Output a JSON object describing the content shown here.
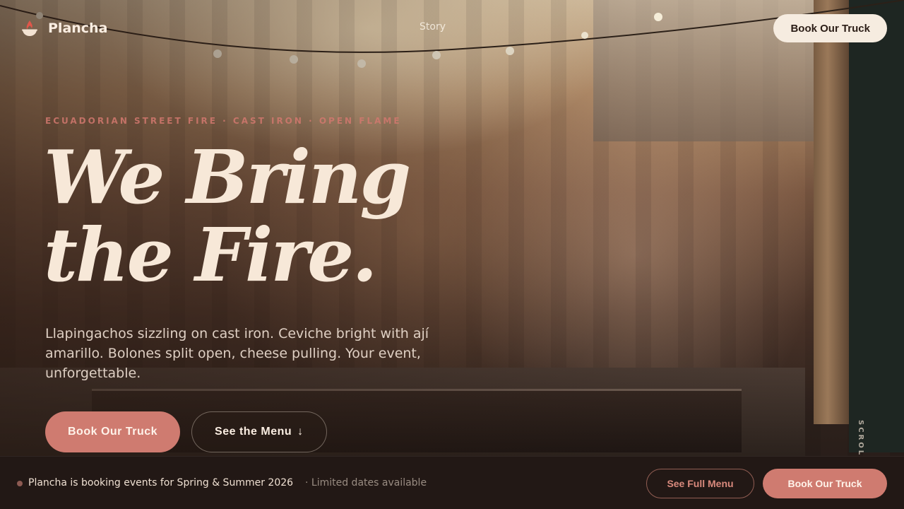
{
  "brand": {
    "name": "Plancha",
    "icon": "flame-grill-icon"
  },
  "nav": {
    "links": [
      "Story"
    ],
    "cta_label": "Book Our Truck"
  },
  "hero": {
    "eyebrow": "ECUADORIAN STREET FIRE · CAST IRON · OPEN FLAME",
    "headline_line1": "We Bring",
    "headline_line2": "the Fire.",
    "lede": "Llapingachos sizzling on cast iron. Ceviche bright with ají amarillo. Bolones split open, cheese pulling. Your event, unforgettable.",
    "primary_label": "Book Our Truck",
    "secondary_label": "See the Menu",
    "secondary_icon": "arrow-down-icon",
    "scroll_label": "SCROLL"
  },
  "booking_bar": {
    "status": "Plancha is booking events for Spring & Summer 2026",
    "sub": "· Limited dates available",
    "menu_label": "See Full Menu",
    "book_label": "Book Our Truck"
  },
  "colors": {
    "accent": "#cf7b70",
    "cream": "#f6ece0",
    "dark": "#221815"
  }
}
